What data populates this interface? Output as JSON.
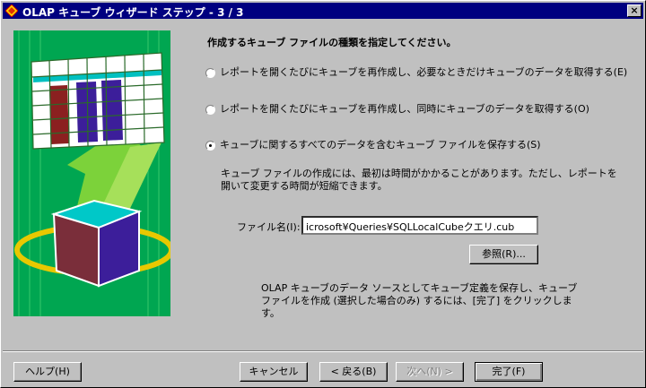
{
  "window": {
    "title": "OLAP キューブ ウィザード ステップ - 3 / 3",
    "close_label": "×"
  },
  "main": {
    "heading": "作成するキューブ ファイルの種類を指定してください。",
    "options": [
      {
        "label": "レポートを開くたびにキューブを再作成し、必要なときだけキューブのデータを取得する(E)",
        "checked": false
      },
      {
        "label": "レポートを開くたびにキューブを再作成し、同時にキューブのデータを取得する(O)",
        "checked": false
      },
      {
        "label": "キューブに関するすべてのデータを含むキューブ ファイルを保存する(S)",
        "checked": true
      }
    ],
    "description": "キューブ ファイルの作成には、最初は時間がかかることがあります。ただし、レポートを開いて変更する時間が短縮できます。",
    "file_label": "ファイル名(I):",
    "file_value": "icrosoft¥Queries¥SQLLocalCubeクエリ.cub",
    "browse_label": "参照(R)...",
    "note": "OLAP キューブのデータ ソースとしてキューブ定義を保存し、キューブ ファイルを作成 (選択した場合のみ) するには、[完了] をクリックします。"
  },
  "footer": {
    "help": "ヘルプ(H)",
    "cancel": "キャンセル",
    "back": "< 戻る(B)",
    "next": "次へ(N) >",
    "finish": "完了(F)"
  },
  "colors": {
    "titlebar": "#000080",
    "illustration_bg": "#00a651",
    "face": "#c0c0c0"
  }
}
